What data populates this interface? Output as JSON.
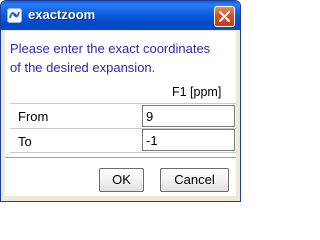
{
  "window": {
    "title": "exactzoom",
    "icon": "app-icon",
    "close_icon": "close-icon",
    "titlebar_color": "#0a5fe3",
    "close_color": "#d4502c"
  },
  "dialog": {
    "message_line1": "Please enter the exact coordinates",
    "message_line2": "of the desired expansion.",
    "message_color": "#2a2ab8",
    "column_header": "F1 [ppm]",
    "rows": [
      {
        "label": "From",
        "value": "9"
      },
      {
        "label": "To",
        "value": "-1"
      }
    ]
  },
  "buttons": {
    "ok_label": "OK",
    "cancel_label": "Cancel"
  }
}
